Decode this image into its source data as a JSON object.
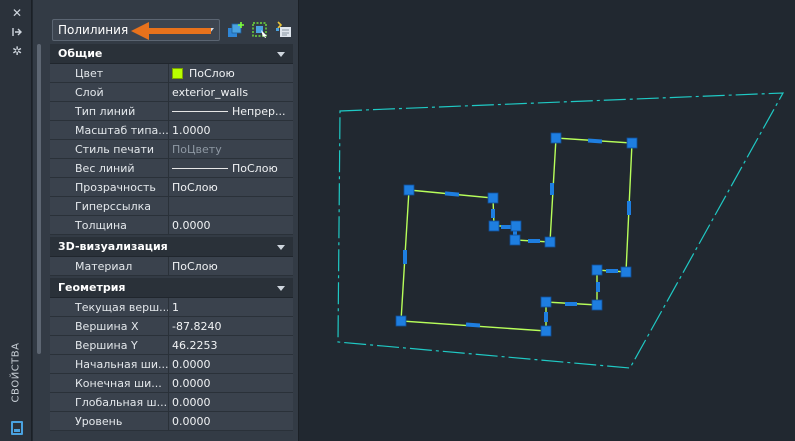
{
  "sidebar": {
    "title": "СВОЙСТВА",
    "icons": [
      "close-icon",
      "pin-icon",
      "settings-icon"
    ]
  },
  "selector": {
    "value": "Полилиния"
  },
  "sections": {
    "general": {
      "title": "Общие",
      "rows": [
        {
          "label": "Цвет",
          "value": "ПоСлою",
          "color": "#b8ff00"
        },
        {
          "label": "Слой",
          "value": "exterior_walls"
        },
        {
          "label": "Тип линий",
          "value": "Непрер..."
        },
        {
          "label": "Масштаб типа...",
          "value": "1.0000"
        },
        {
          "label": "Стиль печати",
          "value": "ПоЦвету"
        },
        {
          "label": "Вес линий",
          "value": "ПоСлою"
        },
        {
          "label": "Прозрачность",
          "value": "ПоСлою"
        },
        {
          "label": "Гиперссылка",
          "value": ""
        },
        {
          "label": "Толщина",
          "value": "0.0000"
        }
      ]
    },
    "visual3d": {
      "title": "3D-визуализация",
      "rows": [
        {
          "label": "Материал",
          "value": "ПоСлою"
        }
      ]
    },
    "geometry": {
      "title": "Геометрия",
      "rows": [
        {
          "label": "Текущая верш...",
          "value": "1"
        },
        {
          "label": "Вершина X",
          "value": "-87.8240"
        },
        {
          "label": "Вершина Y",
          "value": "46.2253"
        },
        {
          "label": "Начальная ши...",
          "value": "0.0000"
        },
        {
          "label": "Конечная ши...",
          "value": "0.0000"
        },
        {
          "label": "Глобальная ш...",
          "value": "0.0000"
        },
        {
          "label": "Уровень",
          "value": "0.0000"
        }
      ]
    }
  },
  "colors": {
    "annotation_arrow": "#e8721c",
    "grip": "#1e7ee0",
    "polyline": "#b8ff5a",
    "boundary": "#1fc9c4",
    "canvas_bg": "#212830"
  }
}
